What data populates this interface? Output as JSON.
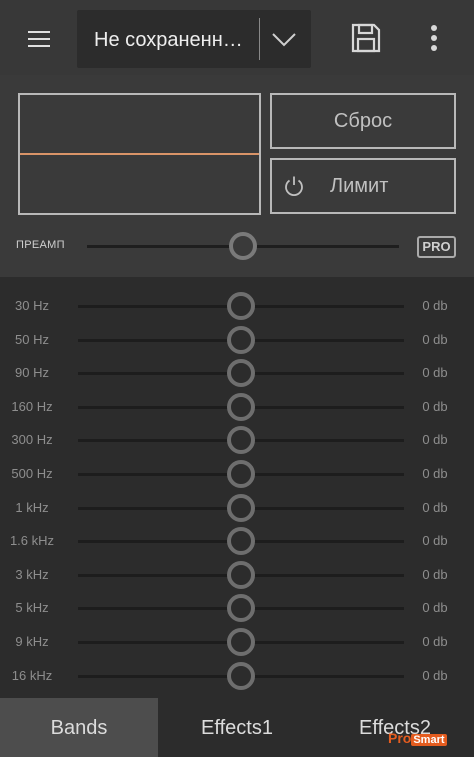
{
  "header": {
    "menu_icon": "hamburger-menu-icon",
    "preset_name": "Не сохраненн…",
    "dropdown_icon": "chevron-down-icon",
    "save_icon": "floppy-disk-icon",
    "more_icon": "more-vertical-icon"
  },
  "panel": {
    "graph_line_color": "#d99468",
    "reset_label": "Сброс",
    "limit_label": "Лимит",
    "limit_icon": "power-icon",
    "preamp_label": "ПРЕАМП",
    "preamp_level": 0.5,
    "pro_badge": "PRO"
  },
  "bands": [
    {
      "freq": "30 Hz",
      "value": "0 db"
    },
    {
      "freq": "50 Hz",
      "value": "0 db"
    },
    {
      "freq": "90 Hz",
      "value": "0 db"
    },
    {
      "freq": "160 Hz",
      "value": "0 db"
    },
    {
      "freq": "300 Hz",
      "value": "0 db"
    },
    {
      "freq": "500 Hz",
      "value": "0 db"
    },
    {
      "freq": "1 kHz",
      "value": "0 db"
    },
    {
      "freq": "1.6 kHz",
      "value": "0 db"
    },
    {
      "freq": "3 kHz",
      "value": "0 db"
    },
    {
      "freq": "5 kHz",
      "value": "0 db"
    },
    {
      "freq": "9 kHz",
      "value": "0 db"
    },
    {
      "freq": "16 kHz",
      "value": "0 db"
    }
  ],
  "tabs": {
    "bands": "Bands",
    "effects1": "Effects1",
    "effects2": "Effects2",
    "active": "bands"
  },
  "watermark": {
    "part1": "Pro",
    "part2": "Smart"
  }
}
